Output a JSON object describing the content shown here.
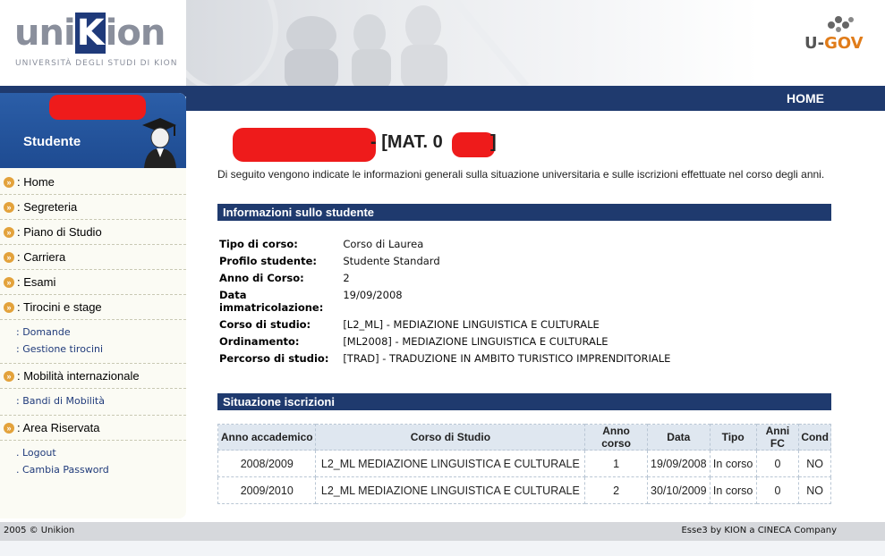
{
  "header": {
    "logo_main_a": "uni",
    "logo_k": "K",
    "logo_main_b": "ion",
    "logo_subtitle": "UNIVERSITÀ DEGLI STUDI DI KION",
    "ugov_u": "U-",
    "ugov_gov": "GOV"
  },
  "nav": {
    "home_label": "HOME"
  },
  "sidebar": {
    "user_role": "Studente",
    "menu": [
      {
        "label": ": Home"
      },
      {
        "label": ": Segreteria"
      },
      {
        "label": ": Piano di Studio"
      },
      {
        "label": ": Carriera"
      },
      {
        "label": ": Esami"
      },
      {
        "label": ": Tirocini e stage",
        "sub": [
          ": Domande",
          ": Gestione tirocini"
        ]
      },
      {
        "label": ": Mobilità internazionale",
        "sub": [
          ": Bandi di Mobilità"
        ]
      },
      {
        "label": ": Area Riservata",
        "sub": [
          ". Logout",
          ". Cambia Password"
        ]
      }
    ]
  },
  "main": {
    "mat_prefix": "- [MAT. 0",
    "mat_suffix": "]",
    "intro": "Di seguito vengono indicate le informazioni generali sulla situazione universitaria e sulle iscrizioni effettuate nel corso degli anni.",
    "info_title": "Informazioni sullo studente",
    "info": [
      {
        "k": "Tipo di corso:",
        "v": "Corso di Laurea"
      },
      {
        "k": "Profilo studente:",
        "v": "Studente Standard"
      },
      {
        "k": "Anno di Corso:",
        "v": "2"
      },
      {
        "k": "Data immatricolazione:",
        "v": "19/09/2008"
      },
      {
        "k": "Corso di studio:",
        "v": "[L2_ML] - MEDIAZIONE LINGUISTICA E CULTURALE"
      },
      {
        "k": "Ordinamento:",
        "v": "[ML2008] - MEDIAZIONE LINGUISTICA E CULTURALE"
      },
      {
        "k": "Percorso di studio:",
        "v": "[TRAD] - TRADUZIONE IN AMBITO TURISTICO IMPRENDITORIALE"
      }
    ],
    "iscr_title": "Situazione iscrizioni",
    "iscr_headers": [
      "Anno accademico",
      "Corso di Studio",
      "Anno corso",
      "Data",
      "Tipo",
      "Anni FC",
      "Cond"
    ],
    "iscr_rows": [
      [
        "2008/2009",
        "L2_ML MEDIAZIONE LINGUISTICA E CULTURALE",
        "1",
        "19/09/2008",
        "In corso",
        "0",
        "NO"
      ],
      [
        "2009/2010",
        "L2_ML MEDIAZIONE LINGUISTICA E CULTURALE",
        "2",
        "30/10/2009",
        "In corso",
        "0",
        "NO"
      ]
    ]
  },
  "footer": {
    "left": "2005 © Unikion",
    "right": "Esse3 by KION a CINECA Company"
  },
  "colors": {
    "navy": "#1f3a6e",
    "accent_orange": "#e3a23b",
    "redaction": "#ee1b1b"
  }
}
